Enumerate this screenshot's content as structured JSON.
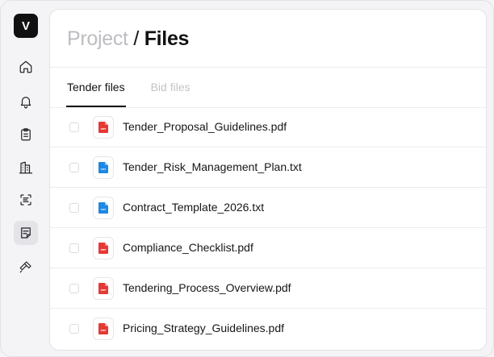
{
  "app": {
    "logo_letter": "V"
  },
  "sidebar": {
    "items": [
      {
        "name": "home",
        "icon": "home-icon",
        "active": false
      },
      {
        "name": "notifications",
        "icon": "bell-icon",
        "active": false
      },
      {
        "name": "clipboard",
        "icon": "clipboard-icon",
        "active": false
      },
      {
        "name": "buildings",
        "icon": "building-icon",
        "active": false
      },
      {
        "name": "scan",
        "icon": "scan-text-icon",
        "active": false
      },
      {
        "name": "documents",
        "icon": "note-icon",
        "active": true
      },
      {
        "name": "tools",
        "icon": "hammer-icon",
        "active": false
      }
    ]
  },
  "header": {
    "breadcrumb_parent": "Project",
    "separator": "/",
    "current": "Files"
  },
  "tabs": [
    {
      "label": "Tender files",
      "active": true
    },
    {
      "label": "Bid files",
      "active": false
    }
  ],
  "files": [
    {
      "name": "Tender_Proposal_Guidelines.pdf",
      "type": "pdf",
      "type_label": "PDF",
      "color": "#e53935",
      "checked": false
    },
    {
      "name": "Tender_Risk_Management_Plan.txt",
      "type": "txt",
      "type_label": "TXT",
      "color": "#1e88e5",
      "checked": false
    },
    {
      "name": "Contract_Template_2026.txt",
      "type": "txt",
      "type_label": "TXT",
      "color": "#1e88e5",
      "checked": false
    },
    {
      "name": "Compliance_Checklist.pdf",
      "type": "pdf",
      "type_label": "PDF",
      "color": "#e53935",
      "checked": false
    },
    {
      "name": "Tendering_Process_Overview.pdf",
      "type": "pdf",
      "type_label": "PDF",
      "color": "#e53935",
      "checked": false
    },
    {
      "name": "Pricing_Strategy_Guidelines.pdf",
      "type": "pdf",
      "type_label": "PDF",
      "color": "#e53935",
      "checked": false
    }
  ]
}
